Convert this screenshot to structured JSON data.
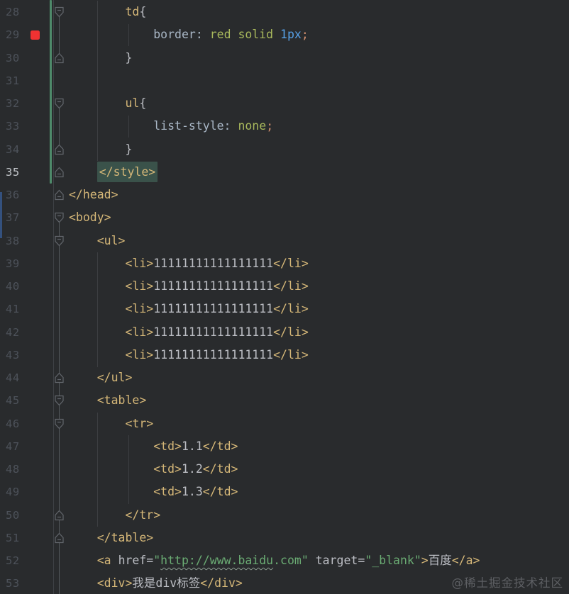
{
  "editor": {
    "watermark": "@稀土掘金技术社区",
    "current_line": 35,
    "breakpoint_line": 29,
    "palette": {
      "background": "#292b2d",
      "tag": "#d5b778",
      "plain_text": "#bcbec4",
      "string": "#6aab73",
      "css_value": "#a8b85c",
      "css_property": "#a9b7c6",
      "number": "#56a0e6",
      "semicolon": "#cf8e6d",
      "line_number": "#4d525a",
      "current_line_number": "#c2c6ca",
      "breakpoint_red": "#f13232",
      "vcs_change_bar": "#4e8a6a",
      "matched_tag_highlight": "#3a524a"
    },
    "lines": [
      {
        "num": 28,
        "fold": "start",
        "indent": 2,
        "tokens": [
          [
            "sel",
            "td"
          ],
          [
            "punc",
            "{"
          ]
        ]
      },
      {
        "num": 29,
        "breakpoint": true,
        "indent": 3,
        "tokens": [
          [
            "prop",
            "border:"
          ],
          [
            "text",
            " "
          ],
          [
            "cssval",
            "red solid"
          ],
          [
            "text",
            " "
          ],
          [
            "num",
            "1px"
          ],
          [
            "semi",
            ";"
          ]
        ]
      },
      {
        "num": 30,
        "fold": "end",
        "indent": 2,
        "tokens": [
          [
            "punc",
            "}"
          ]
        ]
      },
      {
        "num": 31,
        "indent": 0,
        "tokens": []
      },
      {
        "num": 32,
        "fold": "start",
        "indent": 2,
        "tokens": [
          [
            "sel",
            "ul"
          ],
          [
            "punc",
            "{"
          ]
        ]
      },
      {
        "num": 33,
        "indent": 3,
        "tokens": [
          [
            "prop",
            "list-style:"
          ],
          [
            "text",
            " "
          ],
          [
            "cssval",
            "none"
          ],
          [
            "semi",
            ";"
          ]
        ]
      },
      {
        "num": 34,
        "fold": "end",
        "indent": 2,
        "tokens": [
          [
            "punc",
            "}"
          ]
        ]
      },
      {
        "num": 35,
        "fold": "end",
        "current": true,
        "indent": 1,
        "tokens": [
          [
            "tag hl",
            "</style>"
          ]
        ]
      },
      {
        "num": 36,
        "fold": "end",
        "indent": 0,
        "tokens": [
          [
            "tag",
            "</head>"
          ]
        ]
      },
      {
        "num": 37,
        "fold": "start",
        "indent": 0,
        "tokens": [
          [
            "tag",
            "<body>"
          ]
        ]
      },
      {
        "num": 38,
        "fold": "start",
        "indent": 1,
        "tokens": [
          [
            "tag",
            "<ul>"
          ]
        ]
      },
      {
        "num": 39,
        "indent": 2,
        "tokens": [
          [
            "tag",
            "<li>"
          ],
          [
            "text",
            "11111111111111111"
          ],
          [
            "tag",
            "</li>"
          ]
        ]
      },
      {
        "num": 40,
        "indent": 2,
        "tokens": [
          [
            "tag",
            "<li>"
          ],
          [
            "text",
            "11111111111111111"
          ],
          [
            "tag",
            "</li>"
          ]
        ]
      },
      {
        "num": 41,
        "indent": 2,
        "tokens": [
          [
            "tag",
            "<li>"
          ],
          [
            "text",
            "11111111111111111"
          ],
          [
            "tag",
            "</li>"
          ]
        ]
      },
      {
        "num": 42,
        "indent": 2,
        "tokens": [
          [
            "tag",
            "<li>"
          ],
          [
            "text",
            "11111111111111111"
          ],
          [
            "tag",
            "</li>"
          ]
        ]
      },
      {
        "num": 43,
        "indent": 2,
        "tokens": [
          [
            "tag",
            "<li>"
          ],
          [
            "text",
            "11111111111111111"
          ],
          [
            "tag",
            "</li>"
          ]
        ]
      },
      {
        "num": 44,
        "fold": "end",
        "indent": 1,
        "tokens": [
          [
            "tag",
            "</ul>"
          ]
        ]
      },
      {
        "num": 45,
        "fold": "start",
        "indent": 1,
        "tokens": [
          [
            "tag",
            "<table>"
          ]
        ]
      },
      {
        "num": 46,
        "fold": "start",
        "indent": 2,
        "tokens": [
          [
            "tag",
            "<tr>"
          ]
        ]
      },
      {
        "num": 47,
        "indent": 3,
        "tokens": [
          [
            "tag",
            "<td>"
          ],
          [
            "text",
            "1.1"
          ],
          [
            "tag",
            "</td>"
          ]
        ]
      },
      {
        "num": 48,
        "indent": 3,
        "tokens": [
          [
            "tag",
            "<td>"
          ],
          [
            "text",
            "1.2"
          ],
          [
            "tag",
            "</td>"
          ]
        ]
      },
      {
        "num": 49,
        "indent": 3,
        "tokens": [
          [
            "tag",
            "<td>"
          ],
          [
            "text",
            "1.3"
          ],
          [
            "tag",
            "</td>"
          ]
        ]
      },
      {
        "num": 50,
        "fold": "end",
        "indent": 2,
        "tokens": [
          [
            "tag",
            "</tr>"
          ]
        ]
      },
      {
        "num": 51,
        "fold": "end",
        "indent": 1,
        "tokens": [
          [
            "tag",
            "</table>"
          ]
        ]
      },
      {
        "num": 52,
        "indent": 1,
        "tokens": [
          [
            "tag",
            "<a"
          ],
          [
            "text",
            " "
          ],
          [
            "attr",
            "href="
          ],
          [
            "str",
            "\""
          ],
          [
            "str wavy",
            "http://www.baidu"
          ],
          [
            "str",
            ".com\""
          ],
          [
            "text",
            " "
          ],
          [
            "attr",
            "target="
          ],
          [
            "str",
            "\"_blank\""
          ],
          [
            "tag",
            ">"
          ],
          [
            "text",
            "百度"
          ],
          [
            "tag",
            "</a>"
          ]
        ]
      },
      {
        "num": 53,
        "indent": 1,
        "tokens": [
          [
            "tag",
            "<div>"
          ],
          [
            "text",
            "我是div标签"
          ],
          [
            "tag",
            "</div>"
          ]
        ]
      }
    ]
  }
}
